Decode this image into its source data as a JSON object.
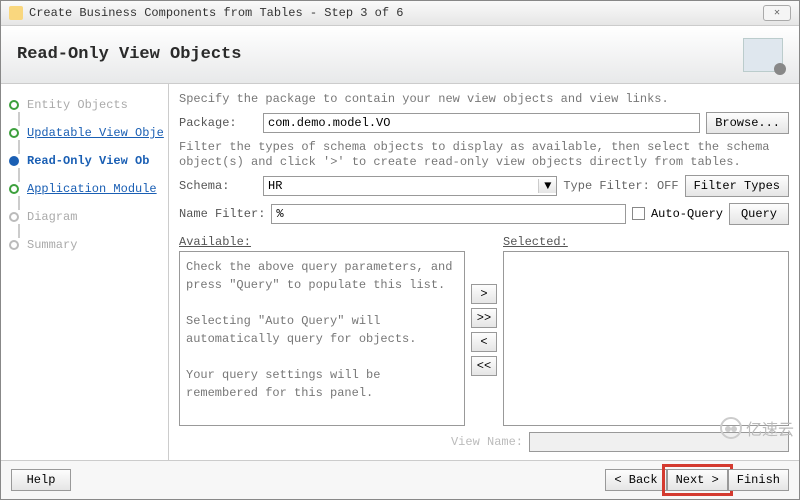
{
  "window": {
    "title": "Create Business Components from Tables - Step 3 of 6",
    "close_glyph": "✕"
  },
  "header": {
    "title": "Read-Only View Objects"
  },
  "steps": [
    {
      "label": "Entity Objects",
      "state": "done"
    },
    {
      "label": "Updatable View Obje",
      "state": "done-link"
    },
    {
      "label": "Read-Only View Ob",
      "state": "current"
    },
    {
      "label": "Application Module",
      "state": "link"
    },
    {
      "label": "Diagram",
      "state": "disabled"
    },
    {
      "label": "Summary",
      "state": "disabled"
    }
  ],
  "main": {
    "instr1": "Specify the package to contain your new view objects and view links.",
    "package_label": "Package:",
    "package_value": "com.demo.model.VO",
    "browse": "Browse...",
    "instr2": "Filter the types of schema objects to display as available, then select the schema object(s) and click '>' to create read-only view objects directly from tables.",
    "schema_label": "Schema:",
    "schema_value": "HR",
    "type_filter_label": "Type Filter: OFF",
    "filter_types": "Filter Types",
    "name_filter_label": "Name Filter:",
    "name_filter_value": "%",
    "auto_query": "Auto-Query",
    "query": "Query",
    "available_label": "Available:",
    "available_hint": "Check the above query parameters, and press \"Query\" to populate this list.\n\nSelecting \"Auto Query\" will automatically query for objects.\n\nYour query settings will be remembered for this panel.",
    "selected_label": "Selected:",
    "view_name_label": "View Name:",
    "view_name_value": ""
  },
  "shuttle": {
    "add": ">",
    "add_all": ">>",
    "remove": "<",
    "remove_all": "<<"
  },
  "footer": {
    "help": "Help",
    "back": "< Back",
    "next": "Next >",
    "finish": "Finish"
  },
  "watermark": "亿速云"
}
